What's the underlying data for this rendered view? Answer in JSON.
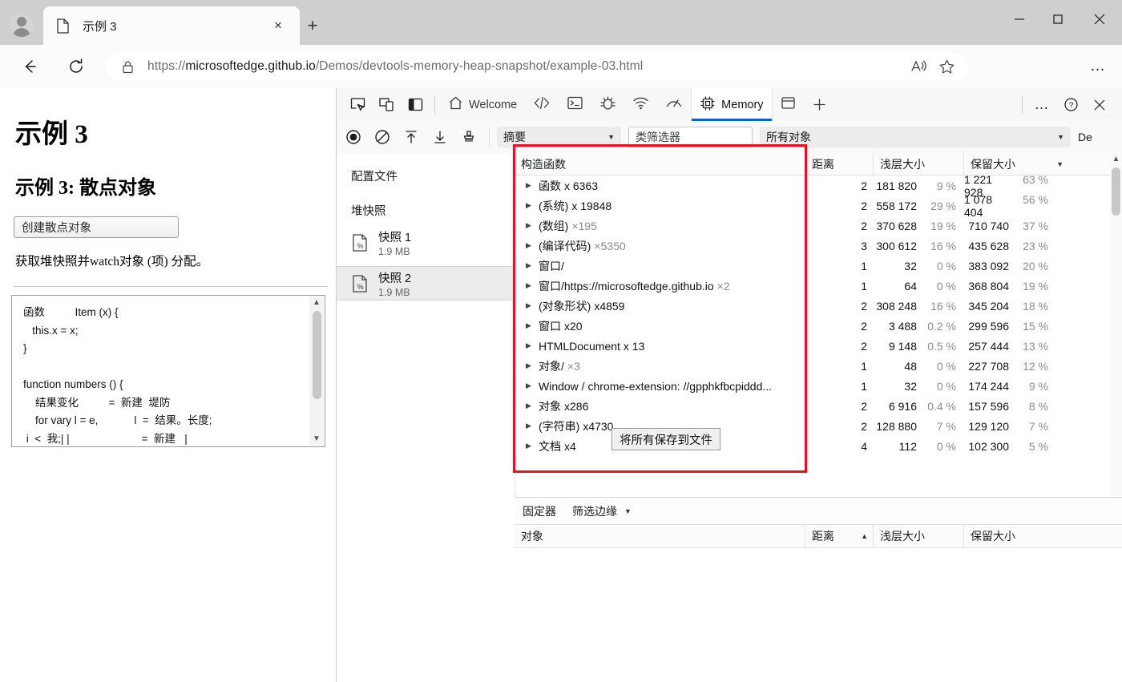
{
  "browser": {
    "tab": {
      "title": "示例 3",
      "favicon": "document-icon",
      "close": "×"
    },
    "newtab_label": "+",
    "window_controls": {
      "minimize": "–",
      "maximize": "◻",
      "close": "✕"
    },
    "url_prefix": "https://",
    "url_domain": "microsoftedge.github.io",
    "url_path": "/Demos/devtools-memory-heap-snapshot/example-03.html",
    "read_aloud_icon": "read-aloud-icon",
    "favorite_icon": "star-icon",
    "settings_label": "…"
  },
  "page": {
    "h1": "示例 3",
    "h2": "示例 3: 散点对象",
    "button": "创建散点对象",
    "paragraph": "获取堆快照并watch对象 (项) 分配。",
    "code": "函数          Item (x) {\n   this.x = x;\n}\n\nfunction numbers () {\n    结果变化          =  新建  堤防\n    for vary l = e,            l  =  结果。长度;\n i  <  我;| |                        =  新建   |\n    返回 new        项 (结果);"
  },
  "devtools": {
    "tools": [
      "inspect-icon",
      "device-emulation-icon",
      "dock-side-icon"
    ],
    "tabs": [
      {
        "label": "Welcome",
        "icon": "home-icon",
        "active": false
      },
      {
        "label": "",
        "icon": "elements-icon",
        "active": false
      },
      {
        "label": "",
        "icon": "console-icon",
        "active": false
      },
      {
        "label": "",
        "icon": "sources-icon",
        "active": false
      },
      {
        "label": "",
        "icon": "network-icon",
        "active": false
      },
      {
        "label": "",
        "icon": "performance-icon",
        "active": false
      },
      {
        "label": "Memory",
        "icon": "memory-icon",
        "active": true
      },
      {
        "label": "",
        "icon": "application-icon",
        "active": false
      },
      {
        "label": "",
        "icon": "more-tabs-plus-icon",
        "active": false
      }
    ],
    "tabbar_right": {
      "more": "…",
      "help": "?",
      "close": "✕"
    },
    "toolbar": {
      "record_icon": "record-icon",
      "clear_icon": "clear-icon",
      "load_icon": "load-up-icon",
      "save_icon": "save-down-icon",
      "gc_icon": "collect-garbage-icon",
      "view_select": "摘要",
      "class_filter_placeholder": "类筛选器",
      "objects_select": "所有对象",
      "trailing": "De"
    },
    "sidebar": {
      "title": "配置文件",
      "section": "堆快照",
      "snapshots": [
        {
          "name": "快照 1",
          "size": "1.9 MB",
          "selected": false
        },
        {
          "name": "快照 2",
          "size": "1.9 MB",
          "selected": true
        }
      ]
    },
    "grid": {
      "headers": [
        "构造函数",
        "距离",
        "浅层大小",
        "保留大小"
      ],
      "sort_col": 3,
      "sort_dir": "▼",
      "rows": [
        {
          "name": "函数",
          "count": "x 6363",
          "count_strong": true,
          "distance": "2",
          "shallow": "181 820",
          "shallow_pct": "9 %",
          "retained": "1 221 928",
          "retained_pct": "63 %"
        },
        {
          "name": "(系统)",
          "count": "x 19848",
          "count_strong": true,
          "distance": "2",
          "shallow": "558 172",
          "shallow_pct": "29 %",
          "retained": "1 078 404",
          "retained_pct": "56 %"
        },
        {
          "name": "(数组)",
          "count": "×195",
          "count_strong": false,
          "distance": "2",
          "shallow": "370 628",
          "shallow_pct": "19 %",
          "retained": "710 740",
          "retained_pct": "37 %"
        },
        {
          "name": "(编译代码)",
          "count": "×5350",
          "count_strong": false,
          "distance": "3",
          "shallow": "300 612",
          "shallow_pct": "16 %",
          "retained": "435 628",
          "retained_pct": "23 %"
        },
        {
          "name": "窗口/",
          "count": "",
          "count_strong": false,
          "distance": "1",
          "shallow": "32",
          "shallow_pct": "0 %",
          "retained": "383 092",
          "retained_pct": "20 %"
        },
        {
          "name": "窗口/https://microsoftedge.github.io",
          "count": "×2",
          "count_strong": false,
          "distance": "1",
          "shallow": "64",
          "shallow_pct": "0 %",
          "retained": "368 804",
          "retained_pct": "19 %"
        },
        {
          "name": "(对象形状)",
          "count": "x4859",
          "count_strong": true,
          "distance": "2",
          "shallow": "308 248",
          "shallow_pct": "16 %",
          "retained": "345 204",
          "retained_pct": "18 %"
        },
        {
          "name": "窗口",
          "count": "x20",
          "count_strong": true,
          "distance": "2",
          "shallow": "3 488",
          "shallow_pct": "0.2 %",
          "retained": "299 596",
          "retained_pct": "15 %"
        },
        {
          "name": "HTMLDocument",
          "count": "x 13",
          "count_strong": true,
          "distance": "2",
          "shallow": "9 148",
          "shallow_pct": "0.5 %",
          "retained": "257 444",
          "retained_pct": "13 %"
        },
        {
          "name": "对象/",
          "count": "×3",
          "count_strong": false,
          "distance": "1",
          "shallow": "48",
          "shallow_pct": "0 %",
          "retained": "227 708",
          "retained_pct": "12 %"
        },
        {
          "name": "Window / chrome-extension: //gpphkfbcpiddd...",
          "count": "",
          "count_strong": false,
          "distance": "1",
          "shallow": "32",
          "shallow_pct": "0 %",
          "retained": "174 244",
          "retained_pct": "9 %"
        },
        {
          "name": "对象",
          "count": "x286",
          "count_strong": true,
          "distance": "2",
          "shallow": "6 916",
          "shallow_pct": "0.4 %",
          "retained": "157 596",
          "retained_pct": "8 %"
        },
        {
          "name": "(字符串)",
          "count": "x4730",
          "count_strong": true,
          "distance": "2",
          "shallow": "128 880",
          "shallow_pct": "7 %",
          "retained": "129 120",
          "retained_pct": "7 %"
        },
        {
          "name": "文档",
          "count": "x4",
          "count_strong": true,
          "distance": "4",
          "shallow": "112",
          "shallow_pct": "0 %",
          "retained": "102 300",
          "retained_pct": "5 %"
        }
      ]
    },
    "tooltip": "将所有保存到文件",
    "retainers": {
      "title": "固定器",
      "filter_label": "筛选边缘",
      "filter_caret": "▼",
      "headers": [
        "对象",
        "距离",
        "浅层大小",
        "保留大小"
      ],
      "sort_col": 1,
      "sort_dir": "▲",
      "rows": []
    }
  },
  "annotation": {
    "highlight_color": "#e81123"
  }
}
